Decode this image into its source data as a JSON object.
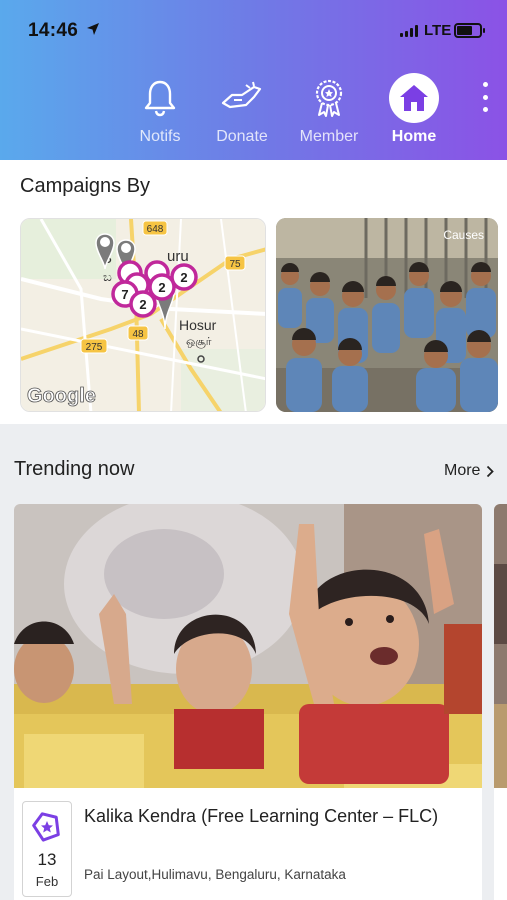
{
  "status_bar": {
    "time": "14:46",
    "network": "LTE"
  },
  "nav": {
    "items": [
      {
        "label": "Notifs",
        "icon": "bell-icon"
      },
      {
        "label": "Donate",
        "icon": "donate-hand-icon"
      },
      {
        "label": "Member",
        "icon": "member-badge-icon"
      },
      {
        "label": "Home",
        "icon": "home-icon",
        "active": true
      }
    ],
    "more_icon": "more-vertical-icon"
  },
  "campaigns": {
    "title": "Campaigns By",
    "map": {
      "labels": {
        "city_part": "B",
        "city_suffix": "uru",
        "city_local": "ಬ",
        "town": "Hosur",
        "town_local": "ஒசூர்",
        "brand": "Google"
      },
      "roads": [
        "648",
        "75",
        "275",
        "48"
      ],
      "clusters": [
        "2",
        "2",
        "7",
        "2"
      ]
    },
    "photo_caption": "Causes"
  },
  "trending": {
    "title": "Trending now",
    "more": "More",
    "card": {
      "title": "Kalika Kendra (Free Learning Center – FLC)",
      "day": "13",
      "month": "Feb",
      "location": "Pai Layout,Hulimavu, Bengaluru, Karnataka"
    }
  },
  "colors": {
    "header_start": "#5aa9ec",
    "header_end": "#8b52e6",
    "accent": "#7b3fe4",
    "marker": "#c0289b",
    "band": "#eceef1"
  }
}
